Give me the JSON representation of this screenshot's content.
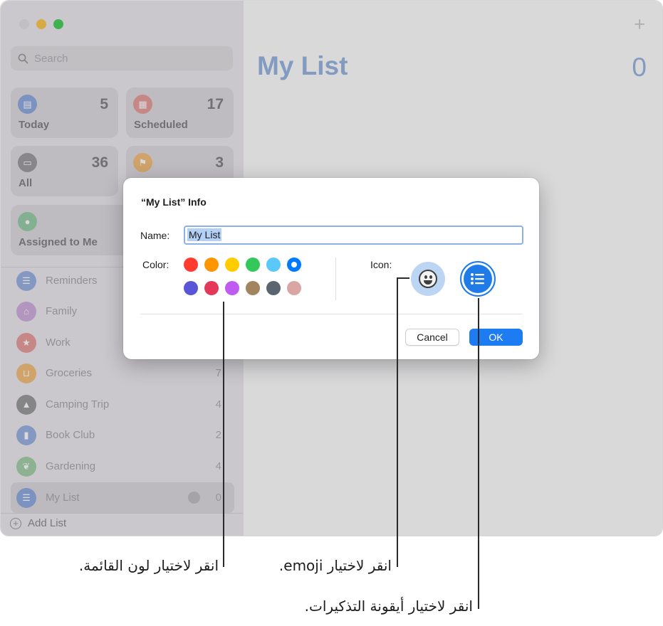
{
  "sidebar": {
    "search_placeholder": "Search",
    "smart_lists": [
      {
        "label": "Today",
        "count": "5",
        "color": "#7f9ddb",
        "icon": "calendar-today-icon"
      },
      {
        "label": "Scheduled",
        "count": "17",
        "color": "#e48f8b",
        "icon": "calendar-scheduled-icon"
      },
      {
        "label": "All",
        "count": "36",
        "color": "#8f8d92",
        "icon": "tray-icon"
      },
      {
        "label": "",
        "count": "3",
        "color": "#f2b465",
        "icon": "flag-icon"
      },
      {
        "label": "Assigned to Me",
        "count": "",
        "color": "#88c79a",
        "icon": "person-icon"
      }
    ],
    "lists": [
      {
        "name": "Reminders",
        "count": "",
        "color": "#8aa6de",
        "icon": "list-bullet-icon"
      },
      {
        "name": "Family",
        "count": "",
        "color": "#c9a2dc",
        "icon": "house-icon"
      },
      {
        "name": "Work",
        "count": "",
        "color": "#e48f8b",
        "icon": "star-icon"
      },
      {
        "name": "Groceries",
        "count": "7",
        "color": "#f2b465",
        "icon": "cart-icon"
      },
      {
        "name": "Camping Trip",
        "count": "4",
        "color": "#8b8a8d",
        "icon": "tent-icon"
      },
      {
        "name": "Book Club",
        "count": "2",
        "color": "#8aa6de",
        "icon": "bookmark-icon"
      },
      {
        "name": "Gardening",
        "count": "4",
        "color": "#96c99c",
        "icon": "leaf-icon"
      },
      {
        "name": "My List",
        "count": "0",
        "color": "#7f9ddb",
        "icon": "list-bullet-icon"
      }
    ],
    "add_list_label": "Add List"
  },
  "main": {
    "title": "My List",
    "count": "0",
    "add_symbol": "+"
  },
  "dialog": {
    "title": "“My List” Info",
    "name_label": "Name:",
    "name_value": "My List",
    "color_label": "Color:",
    "icon_label": "Icon:",
    "colors": [
      "#ff3b30",
      "#ff9500",
      "#ffcc00",
      "#34c759",
      "#5ac8fa",
      "#007aff",
      "#5856d6",
      "#e5375a",
      "#bf5af2",
      "#a2845e",
      "#5b6570",
      "#d9a6a4"
    ],
    "selected_color": "#007aff",
    "cancel_label": "Cancel",
    "ok_label": "OK"
  },
  "callouts": {
    "color": "انقر لاختيار لون القائمة.",
    "emoji": "انقر لاختيار emoji.",
    "icon": "انقر لاختيار أيقونة التذكيرات."
  }
}
